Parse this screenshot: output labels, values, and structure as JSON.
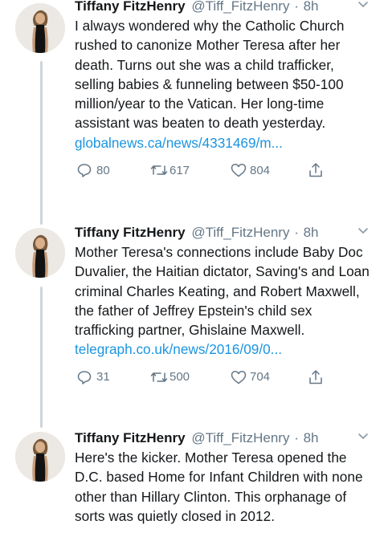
{
  "tweets": [
    {
      "author": {
        "name": "Tiffany FitzHenry",
        "handle": "@Tiff_FitzHenry"
      },
      "separator": "·",
      "time": "8h",
      "text": "I always wondered why the Catholic Church rushed to canonize Mother Teresa after her death. Turns out she was a child trafficker, selling babies & funneling between $50-100 million/year to the Vatican. Her long-time assistant was beaten to death yesterday.",
      "link": "globalnews.ca/news/4331469/m...",
      "stats": {
        "replies": "80",
        "retweets": "617",
        "likes": "804"
      }
    },
    {
      "author": {
        "name": "Tiffany FitzHenry",
        "handle": "@Tiff_FitzHenry"
      },
      "separator": "·",
      "time": "8h",
      "text": "Mother Teresa's connections include Baby Doc Duvalier, the Haitian dictator, Saving's and Loan criminal Charles Keating, and Robert Maxwell, the father of Jeffrey Epstein's child sex trafficking partner, Ghislaine Maxwell.",
      "link": "telegraph.co.uk/news/2016/09/0...",
      "stats": {
        "replies": "31",
        "retweets": "500",
        "likes": "704"
      }
    },
    {
      "author": {
        "name": "Tiffany FitzHenry",
        "handle": "@Tiff_FitzHenry"
      },
      "separator": "·",
      "time": "8h",
      "text": "Here's the kicker. Mother Teresa opened the D.C. based Home for Infant Children with none other than Hillary Clinton. This orphanage of sorts was quietly closed in 2012."
    }
  ],
  "icons": {
    "reply": "reply-icon",
    "retweet": "retweet-icon",
    "like": "heart-icon",
    "share": "share-icon",
    "menu": "chevron-down-icon"
  },
  "colors": {
    "text": "#14171a",
    "secondary": "#657786",
    "link": "#1b95e0",
    "thread_line": "#ccd6dd"
  }
}
